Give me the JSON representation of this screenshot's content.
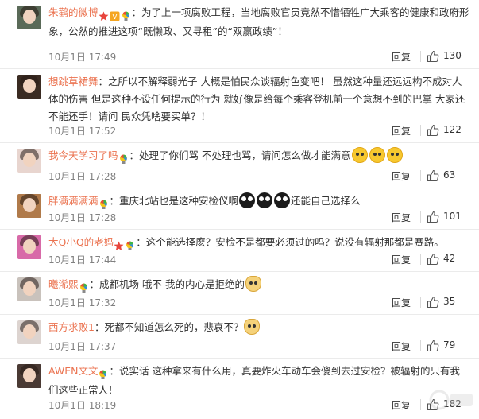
{
  "comments": [
    {
      "user": "朱鹳的微博",
      "badges": [
        "star-badge",
        "vip-badge",
        "colorful-bulb-badge"
      ],
      "text": "：为了上一项腐败工程，当地腐败官员竟然不惜牺牲广大乘客的健康和政府形象，公然的推进这项“既懒政、又寻租”的“双赢政绩”！",
      "emojis": [],
      "text_after": "",
      "time": "10月1日 17:49",
      "reply": "回复",
      "likes": "130",
      "avatar_color": "#5a6a58"
    },
    {
      "user": "想跳草裙舞",
      "badges": [],
      "text": "：之所以不解释弱光子 大概是怕民众谈辐射色变吧！ 虽然这种量还远远构不成对人体的伤害 但是这种不设任何提示的行为 就好像是给每个乘客登机前一个意想不到的巴掌 大家还不能还手！请问 民众凭啥要买单？！",
      "emojis": [],
      "text_after": "",
      "time": "10月1日 17:52",
      "reply": "回复",
      "likes": "122",
      "avatar_color": "#3a2b22"
    },
    {
      "user": "我今天学习了吗",
      "badges": [
        "colorful-bulb-badge"
      ],
      "text": "：处理了你们骂 不处理也骂，请问怎么做才能满意",
      "emojis": [
        "yellow",
        "yellow",
        "yellow"
      ],
      "text_after": "",
      "time": "10月1日 17:28",
      "reply": "回复",
      "likes": "63",
      "avatar_color": "#e8d5cf"
    },
    {
      "user": "胖满满满满",
      "badges": [
        "colorful-bulb-badge"
      ],
      "text": "：重庆北站也是这种安检仪啊",
      "emojis": [
        "black",
        "black",
        "black"
      ],
      "text_after": "还能自己选择么",
      "time": "10月1日 17:28",
      "reply": "回复",
      "likes": "101",
      "avatar_color": "#b07a4a"
    },
    {
      "user": "大Q小Q的老妈",
      "badges": [
        "star-badge",
        "colorful-bulb-badge"
      ],
      "text": "：这个能选择麽？安检不是都要必须过的吗？说没有辐射那都是赛路。",
      "emojis": [],
      "text_after": "",
      "time": "10月1日 17:44",
      "reply": "回复",
      "likes": "42",
      "avatar_color": "#d86aa8"
    },
    {
      "user": "曦浠熙",
      "badges": [
        "colorful-bulb-badge"
      ],
      "text": "：成都机场 哦不 我的内心是拒绝的",
      "emojis": [
        "dog"
      ],
      "text_after": "",
      "time": "10月1日 17:32",
      "reply": "回复",
      "likes": "35",
      "avatar_color": "#c9c2bc"
    },
    {
      "user": "西方求败1",
      "badges": [],
      "text": "：死都不知道怎么死的，悲哀不？",
      "emojis": [
        "dog"
      ],
      "text_after": "",
      "time": "10月1日 17:37",
      "reply": "回复",
      "likes": "79",
      "avatar_color": "#ddd4d0"
    },
    {
      "user": "AWEN文文",
      "badges": [
        "colorful-bulb-badge"
      ],
      "text": "：说实话 这种拿来有什么用，真要炸火车动车会傻到去过安检？被辐射的只有我们这些正常人！",
      "emojis": [],
      "text_after": "",
      "time": "10月1日 18:19",
      "reply": "回复",
      "likes": "182",
      "avatar_color": "#4a3a34"
    }
  ],
  "colors": {
    "username": "#eb7350",
    "text": "#333333",
    "meta": "#808080"
  }
}
